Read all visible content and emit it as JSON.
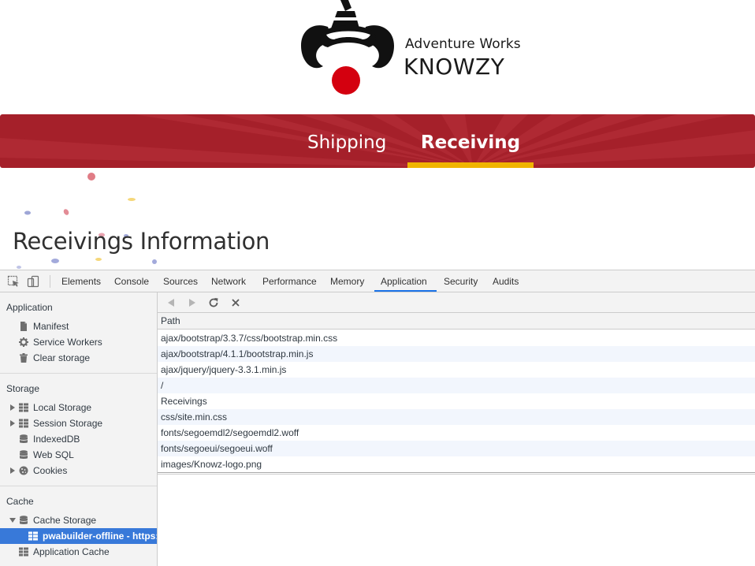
{
  "site": {
    "brand_line1": "Adventure Works",
    "brand_line2": "KNOWZY",
    "nav": [
      {
        "label": "Shipping",
        "active": false
      },
      {
        "label": "Receiving",
        "active": true
      }
    ],
    "heading": "Receivings Information",
    "colors": {
      "navbar": "#a5202a",
      "accent": "#f0b400",
      "logo_red": "#d4000f"
    }
  },
  "devtools": {
    "tabs": [
      "Elements",
      "Console",
      "Sources",
      "Network",
      "Performance",
      "Memory",
      "Application",
      "Security",
      "Audits"
    ],
    "active_tab": "Application",
    "sidebar": {
      "application_section": "Application",
      "application_items": [
        "Manifest",
        "Service Workers",
        "Clear storage"
      ],
      "storage_section": "Storage",
      "storage_items": [
        "Local Storage",
        "Session Storage",
        "IndexedDB",
        "Web SQL",
        "Cookies"
      ],
      "cache_section": "Cache",
      "cache_items": [
        "Cache Storage",
        "pwabuilder-offline - https:/",
        "Application Cache"
      ]
    },
    "table": {
      "column": "Path",
      "rows": [
        "ajax/bootstrap/3.3.7/css/bootstrap.min.css",
        "ajax/bootstrap/4.1.1/bootstrap.min.js",
        "ajax/jquery/jquery-3.3.1.min.js",
        "/",
        "Receivings",
        "css/site.min.css",
        "fonts/segoemdl2/segoemdl2.woff",
        "fonts/segoeui/segoeui.woff",
        "images/Knowz-logo.png"
      ]
    },
    "colors": {
      "selection": "#3879d9",
      "tab_underline": "#1a73e8"
    }
  }
}
